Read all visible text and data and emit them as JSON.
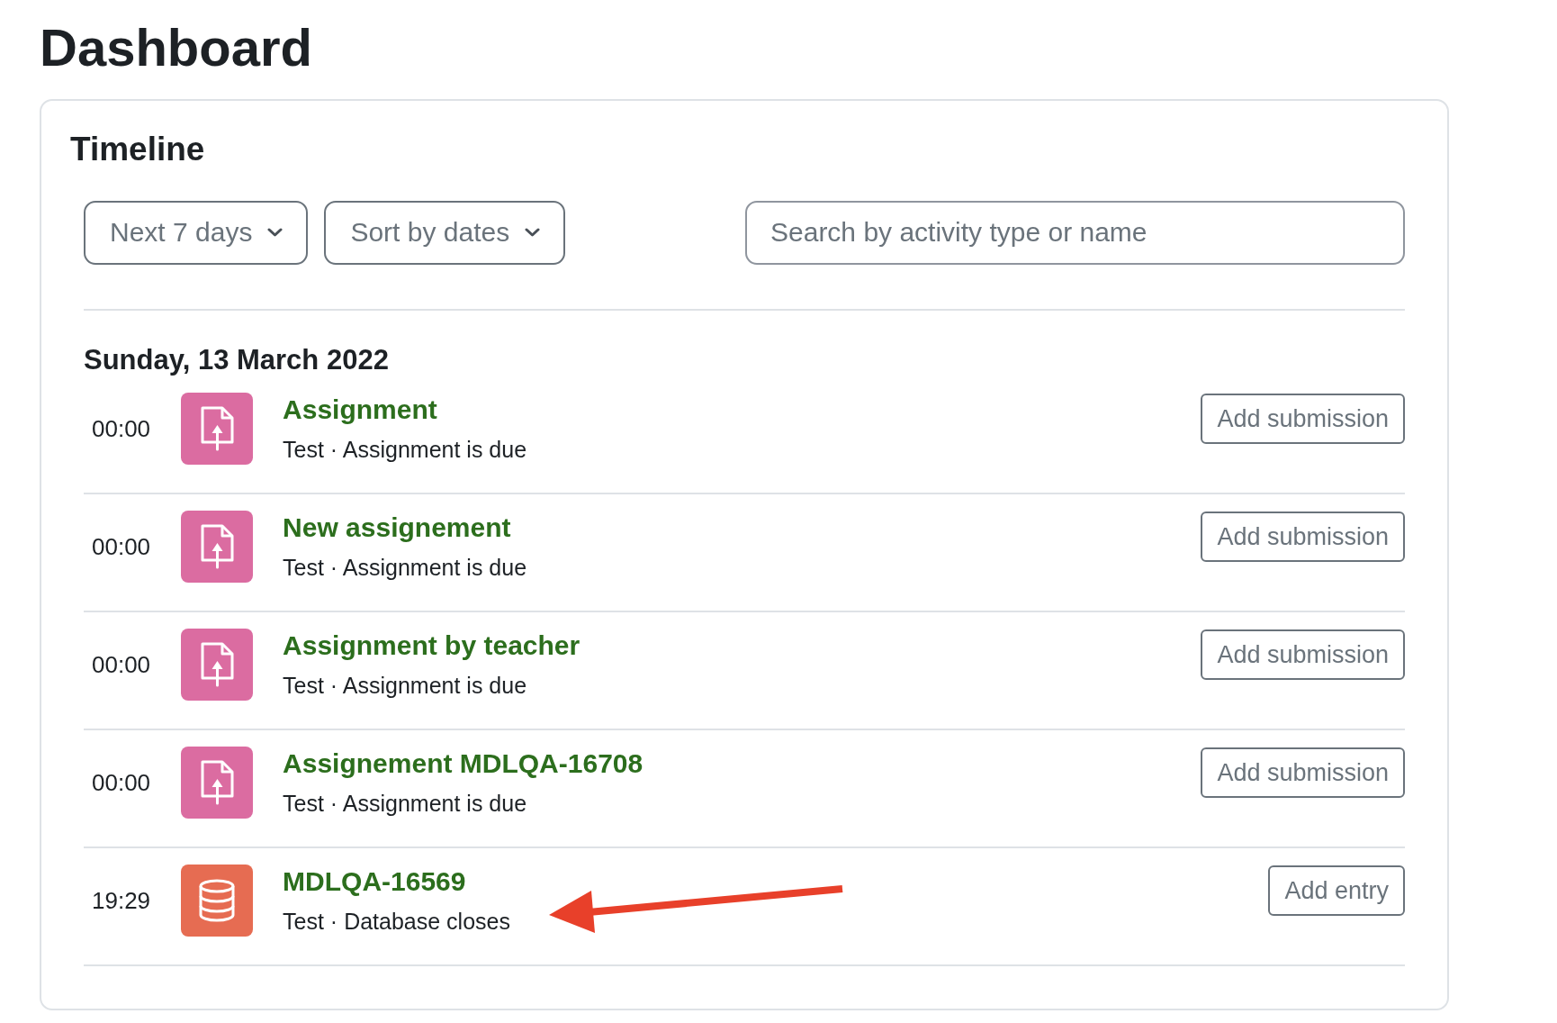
{
  "page_title": "Dashboard",
  "timeline": {
    "title": "Timeline",
    "filters": [
      {
        "label": "Next 7 days"
      },
      {
        "label": "Sort by dates"
      }
    ],
    "search": {
      "placeholder": "Search by activity type or name"
    },
    "days": [
      {
        "date": "Sunday, 13 March 2022",
        "events": [
          {
            "time": "00:00",
            "kind": "assignment",
            "name": "Assignment",
            "details": "Test · Assignment is due",
            "action": "Add submission"
          },
          {
            "time": "00:00",
            "kind": "assignment",
            "name": "New assignement",
            "details": "Test · Assignment is due",
            "action": "Add submission"
          },
          {
            "time": "00:00",
            "kind": "assignment",
            "name": "Assignment by teacher",
            "details": "Test · Assignment is due",
            "action": "Add submission"
          },
          {
            "time": "00:00",
            "kind": "assignment",
            "name": "Assignement MDLQA-16708",
            "details": "Test · Assignment is due",
            "action": "Add submission"
          },
          {
            "time": "19:29",
            "kind": "database",
            "name": "MDLQA-16569",
            "details": "Test · Database closes",
            "action": "Add entry"
          }
        ]
      }
    ]
  }
}
